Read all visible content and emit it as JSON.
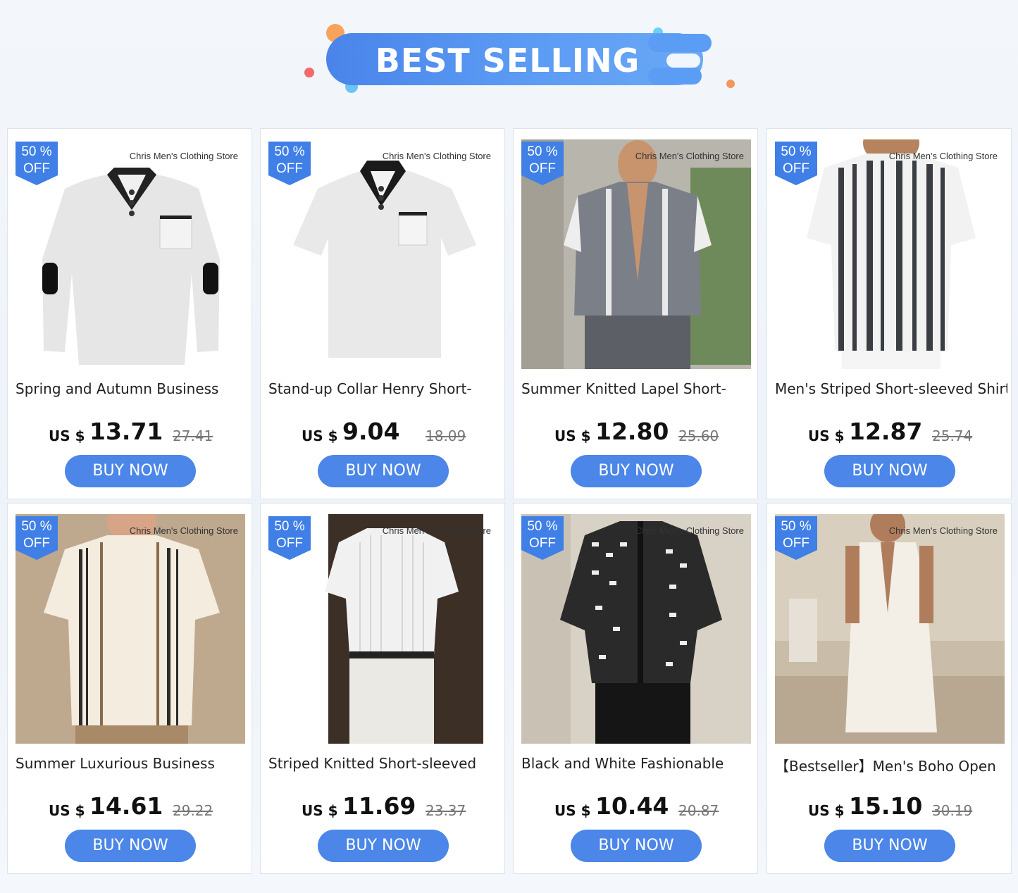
{
  "banner": {
    "title": "BEST SELLING"
  },
  "store_name": "Chris Men's Clothing Store",
  "badge": {
    "percent": "50 %",
    "off": "OFF"
  },
  "button_label": "BUY NOW",
  "currency": "US $",
  "colors": {
    "accent": "#4b86e8",
    "badge": "#3f7fe6"
  },
  "products": [
    {
      "title": "Spring and Autumn Business",
      "price": "13.71",
      "old_price": "27.41",
      "image": "white-long-sleeve-henley"
    },
    {
      "title": "Stand-up Collar Henry Short-",
      "price": "9.04",
      "old_price": "18.09",
      "image": "white-short-sleeve-henley"
    },
    {
      "title": "Summer Knitted Lapel Short-",
      "price": "12.80",
      "old_price": "25.60",
      "image": "grey-knit-lapel-shirt"
    },
    {
      "title": "Men's Striped Short-sleeved Shirt",
      "price": "12.87",
      "old_price": "25.74",
      "image": "vertical-striped-shirt"
    },
    {
      "title": "Summer Luxurious Business",
      "price": "14.61",
      "old_price": "29.22",
      "image": "cream-striped-knit-shirt"
    },
    {
      "title": "Striped Knitted Short-sleeved",
      "price": "11.69",
      "old_price": "23.37",
      "image": "white-knit-polo"
    },
    {
      "title": "Black and White Fashionable",
      "price": "10.44",
      "old_price": "20.87",
      "image": "black-white-pattern-shirt"
    },
    {
      "title": "【Bestseller】Men's Boho Open",
      "price": "15.10",
      "old_price": "30.19",
      "image": "white-boho-jumpsuit"
    }
  ]
}
